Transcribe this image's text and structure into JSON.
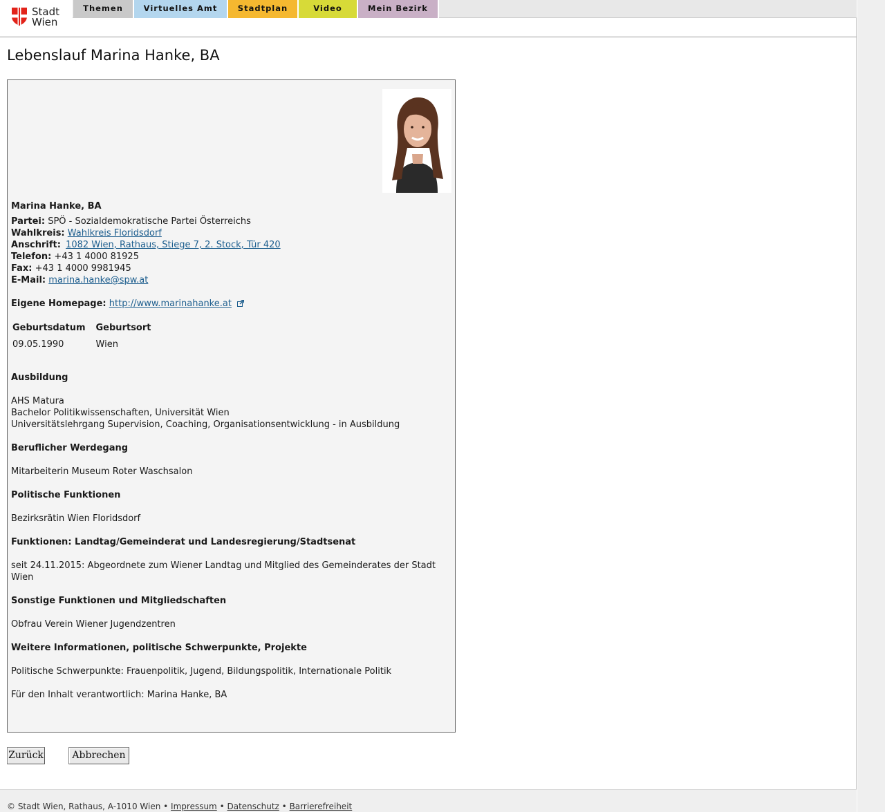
{
  "header": {
    "logo_line1": "Stadt",
    "logo_line2": "Wien",
    "tabs": [
      "Themen",
      "Virtuelles Amt",
      "Stadtplan",
      "Video",
      "Mein Bezirk"
    ]
  },
  "page_title": "Lebenslauf Marina Hanke, BA",
  "profile": {
    "name": "Marina Hanke, BA",
    "partei_label": "Partei:",
    "partei": "SPÖ - Sozialdemokratische Partei Österreichs",
    "wahlkreis_label": "Wahlkreis:",
    "wahlkreis": "Wahlkreis Floridsdorf",
    "anschrift_label": "Anschrift:",
    "anschrift": "1082 Wien, Rathaus, Stiege 7, 2. Stock, Tür 420",
    "telefon_label": "Telefon:",
    "telefon": "+43 1 4000 81925",
    "fax_label": "Fax:",
    "fax": "+43 1 4000 9981945",
    "email_label": "E-Mail:",
    "email": "marina.hanke@spw.at",
    "homepage_label": "Eigene Homepage:",
    "homepage": "http://www.marinahanke.at",
    "table": {
      "headers": [
        "Geburtsdatum",
        "Geburtsort"
      ],
      "row": [
        "09.05.1990",
        "Wien"
      ]
    }
  },
  "sections": {
    "ausbildung_title": "Ausbildung",
    "ausbildung": [
      "AHS Matura",
      "Bachelor Politikwissenschaften, Universität Wien",
      "Universitätslehrgang Supervision, Coaching, Organisationsentwicklung - in Ausbildung"
    ],
    "beruf_title": "Beruflicher Werdegang",
    "beruf": "Mitarbeiterin Museum Roter Waschsalon",
    "polit_title": "Politische Funktionen",
    "polit": "Bezirksrätin Wien Floridsdorf",
    "funktionen_title": "Funktionen: Landtag/Gemeinderat und Landesregierung/Stadtsenat",
    "funktionen": "seit 24.11.2015: Abgeordnete zum Wiener Landtag und Mitglied des Gemeinderates der Stadt Wien",
    "sonstige_title": "Sonstige Funktionen und Mitgliedschaften",
    "sonstige": "Obfrau Verein Wiener Jugendzentren",
    "weitere_title": "Weitere Informationen, politische Schwerpunkte, Projekte",
    "weitere": "Politische Schwerpunkte: Frauenpolitik, Jugend, Bildungspolitik, Internationale Politik",
    "verantwortlich": "Für den Inhalt verantwortlich: Marina Hanke, BA"
  },
  "buttons": {
    "back": "Zurück",
    "cancel": "Abbrechen"
  },
  "footer": {
    "copyright": "© Stadt Wien, Rathaus, A-1010 Wien",
    "sep": "•",
    "impressum": "Impressum",
    "datenschutz": "Datenschutz",
    "barrierefreiheit": "Barrierefreiheit"
  },
  "colors": {
    "tab_themen": "#c9c9c9",
    "tab_amt": "#b3d6ee",
    "tab_stadtplan": "#f5b830",
    "tab_video": "#d7da38",
    "tab_bezirk": "#c9b0c6",
    "link": "#1d5e8e",
    "logo_red": "#e2231a"
  }
}
